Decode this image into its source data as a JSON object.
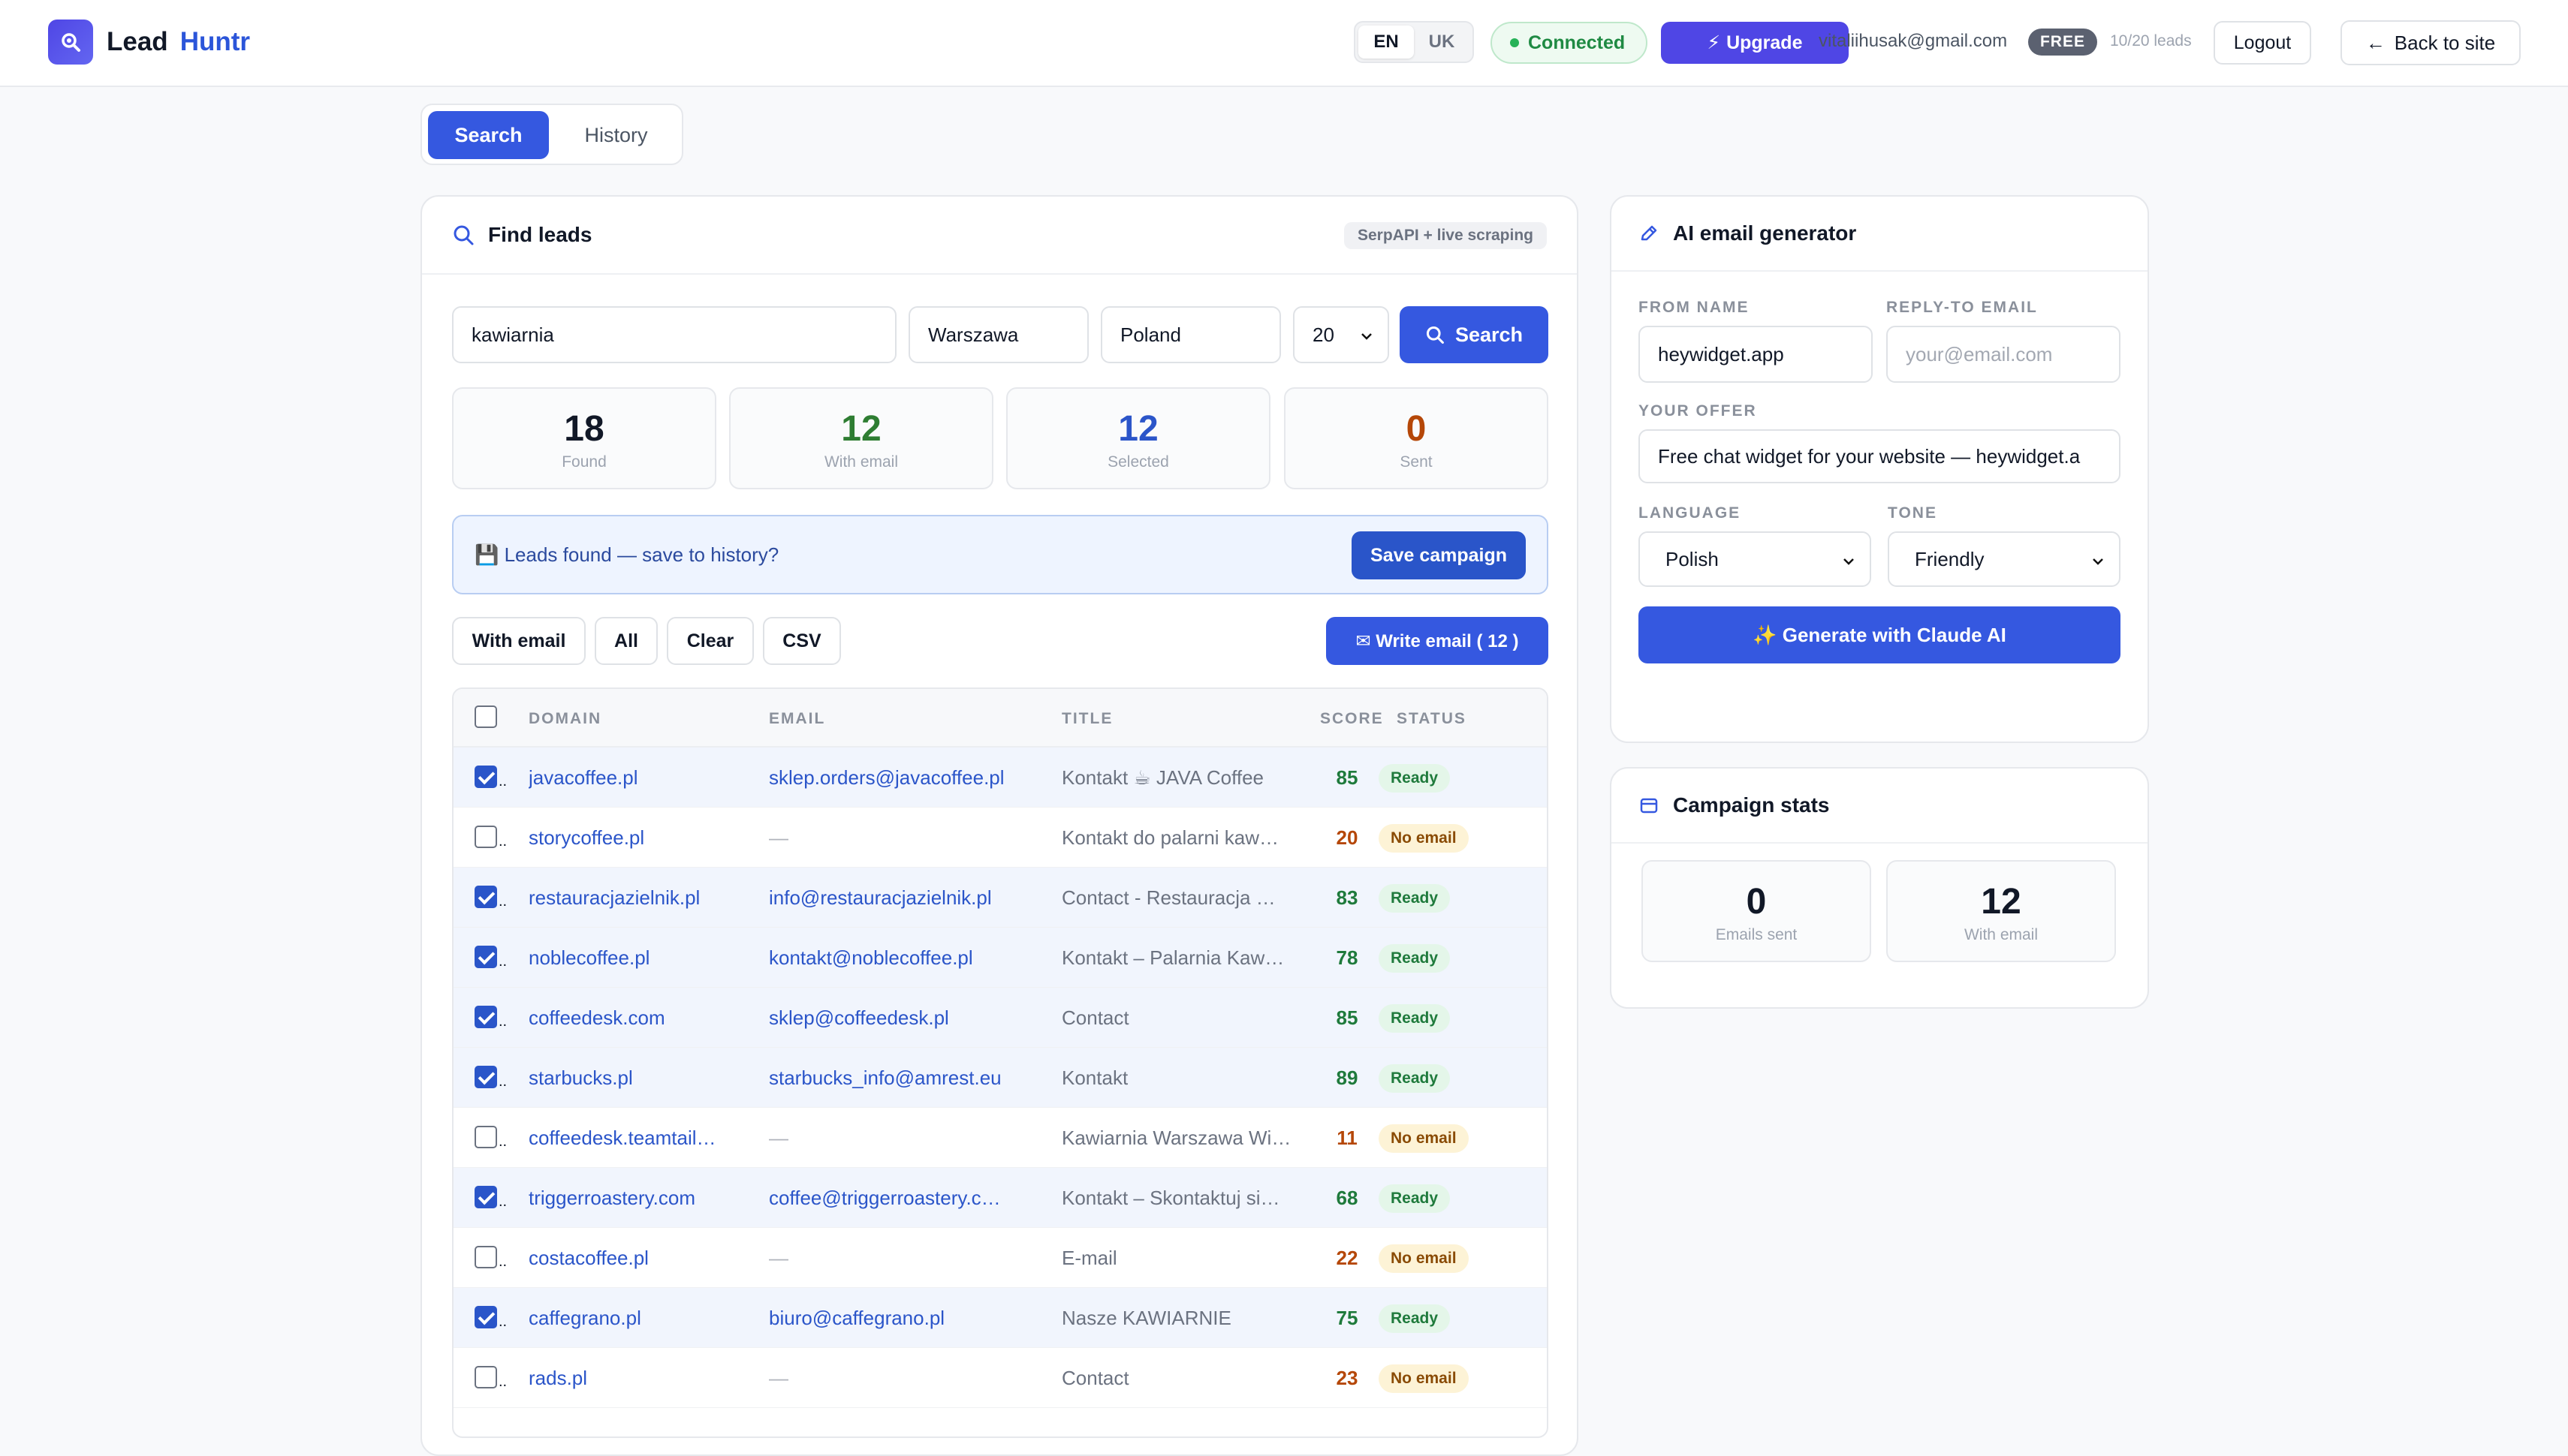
{
  "header": {
    "brand_first": "Lead",
    "brand_second": "Huntr",
    "lang_en": "EN",
    "lang_uk": "UK",
    "connected": "Connected",
    "upgrade": "Upgrade",
    "user_email": "vitaliihusak@gmail.com",
    "plan": "FREE",
    "leads_usage": "10/20 leads",
    "logout": "Logout",
    "back": "Back to site"
  },
  "tabs": {
    "search": "Search",
    "history": "History"
  },
  "find": {
    "title": "Find leads",
    "source_tag": "SerpAPI + live scraping",
    "query": "kawiarnia",
    "city": "Warszawa",
    "country": "Poland",
    "limit": "20",
    "search_btn": "Search"
  },
  "stats": [
    {
      "value": "18",
      "label": "Found",
      "color": "#111827"
    },
    {
      "value": "12",
      "label": "With email",
      "color": "#2e7d32"
    },
    {
      "value": "12",
      "label": "Selected",
      "color": "#2b55c9"
    },
    {
      "value": "0",
      "label": "Sent",
      "color": "#b54708"
    }
  ],
  "banner": {
    "text": "💾 Leads found — save to history?",
    "button": "Save campaign"
  },
  "filters": {
    "with_email": "With email",
    "all": "All",
    "clear": "Clear",
    "csv": "CSV",
    "write_email": "✉ Write email ( 12 )"
  },
  "table": {
    "headers": {
      "domain": "DOMAIN",
      "email": "EMAIL",
      "title": "TITLE",
      "score": "SCORE",
      "status": "STATUS"
    },
    "rows": [
      {
        "domain": "javacoffee.pl",
        "email": "sklep.orders@javacoffee.pl",
        "title": "Kontakt ☕ JAVA Coffee",
        "score": "85",
        "status": "Ready",
        "selected": true
      },
      {
        "domain": "storycoffee.pl",
        "email": "—",
        "title": "Kontakt do palarni kaw…",
        "score": "20",
        "status": "No email",
        "selected": false
      },
      {
        "domain": "restauracjazielnik.pl",
        "email": "info@restauracjazielnik.pl",
        "title": "Contact - Restauracja …",
        "score": "83",
        "status": "Ready",
        "selected": true
      },
      {
        "domain": "noblecoffee.pl",
        "email": "kontakt@noblecoffee.pl",
        "title": "Kontakt – Palarnia Kaw…",
        "score": "78",
        "status": "Ready",
        "selected": true
      },
      {
        "domain": "coffeedesk.com",
        "email": "sklep@coffeedesk.pl",
        "title": "Contact",
        "score": "85",
        "status": "Ready",
        "selected": true
      },
      {
        "domain": "starbucks.pl",
        "email": "starbucks_info@amrest.eu",
        "title": "Kontakt",
        "score": "89",
        "status": "Ready",
        "selected": true
      },
      {
        "domain": "coffeedesk.teamtail…",
        "email": "—",
        "title": "Kawiarnia Warszawa Wi…",
        "score": "11",
        "status": "No email",
        "selected": false
      },
      {
        "domain": "triggerroastery.com",
        "email": "coffee@triggerroastery.c…",
        "title": "Kontakt – Skontaktuj si…",
        "score": "68",
        "status": "Ready",
        "selected": true
      },
      {
        "domain": "costacoffee.pl",
        "email": "—",
        "title": "E-mail",
        "score": "22",
        "status": "No email",
        "selected": false
      },
      {
        "domain": "caffegrano.pl",
        "email": "biuro@caffegrano.pl",
        "title": "Nasze KAWIARNIE",
        "score": "75",
        "status": "Ready",
        "selected": true
      },
      {
        "domain": "rads.pl",
        "email": "—",
        "title": "Contact",
        "score": "23",
        "status": "No email",
        "selected": false
      }
    ]
  },
  "ai": {
    "title": "AI email generator",
    "from_name_label": "FROM NAME",
    "from_name": "heywidget.app",
    "reply_label": "REPLY-TO EMAIL",
    "reply_placeholder": "your@email.com",
    "offer_label": "YOUR OFFER",
    "offer": "Free chat widget for your website — heywidget.a",
    "language_label": "LANGUAGE",
    "language": "Polish",
    "tone_label": "TONE",
    "tone": "Friendly",
    "generate": "✨ Generate with Claude AI"
  },
  "campaign": {
    "title": "Campaign stats",
    "sent_value": "0",
    "sent_label": "Emails sent",
    "with_email_value": "12",
    "with_email_label": "With email"
  }
}
